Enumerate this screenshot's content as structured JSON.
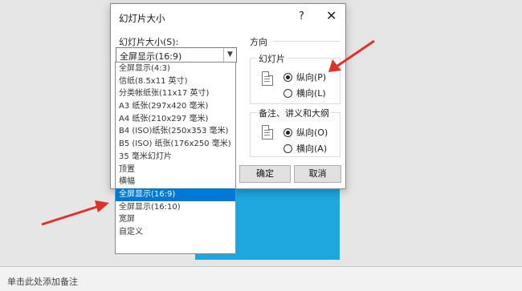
{
  "dialog": {
    "title": "幻灯片大小",
    "help": "?",
    "close": "✕",
    "size_label": "幻灯片大小(S):",
    "size_value": "全屏显示(16:9)",
    "orientation_label": "方向",
    "slides_group": {
      "title": "幻灯片",
      "portrait": "纵向(P)",
      "landscape": "横向(L)",
      "selected": "portrait"
    },
    "notes_group": {
      "title": "备注、讲义和大纲",
      "portrait": "纵向(O)",
      "landscape": "横向(A)",
      "selected": "portrait"
    },
    "ok_label": "确定",
    "cancel_label": "取消"
  },
  "dropdown": {
    "items": [
      "全屏显示(4:3)",
      "信纸(8.5x11 英寸)",
      "分类帐纸张(11x17 英寸)",
      "A3 纸张(297x420 毫米)",
      "A4 纸张(210x297 毫米)",
      "B4 (ISO)纸张(250x353 毫米)",
      "B5 (ISO) 纸张(176x250 毫米)",
      "35 毫米幻灯片",
      "顶置",
      "横幅",
      "全屏显示(16:9)",
      "全屏显示(16:10)",
      "宽屏",
      "自定义"
    ],
    "selected_index": 10
  },
  "notes_bar": {
    "placeholder": "单击此处添加备注"
  },
  "colors": {
    "selection": "#0078d7",
    "slide": "#1ea7df",
    "arrow": "#e0312b"
  }
}
